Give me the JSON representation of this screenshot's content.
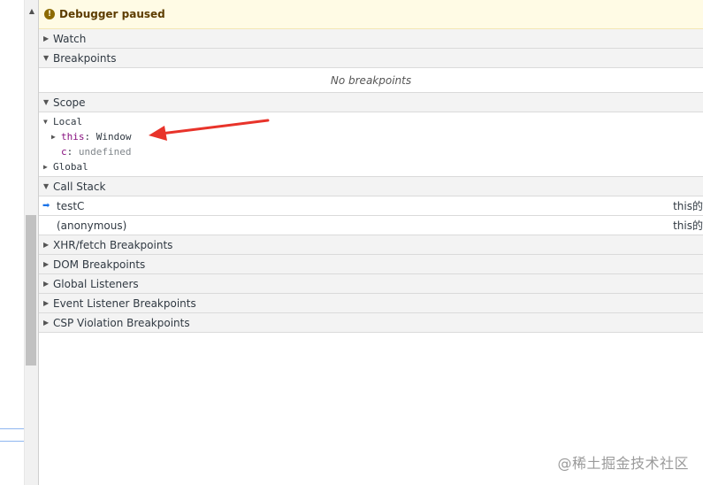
{
  "status": {
    "text": "Debugger paused",
    "icon": "pause-info-icon"
  },
  "sections": {
    "watch": "Watch",
    "breakpoints": "Breakpoints",
    "no_breakpoints": "No breakpoints",
    "scope": "Scope",
    "call_stack": "Call Stack",
    "xhr": "XHR/fetch Breakpoints",
    "dom": "DOM Breakpoints",
    "global_listeners": "Global Listeners",
    "event_listener": "Event Listener Breakpoints",
    "csp": "CSP Violation Breakpoints"
  },
  "scope": {
    "local": "Local",
    "this_name": "this",
    "this_sep": ": ",
    "this_value": "Window",
    "c_name": "c",
    "c_sep": ": ",
    "c_value": "undefined",
    "global": "Global"
  },
  "call_stack": [
    {
      "name": "testC",
      "location": "this的",
      "current": true
    },
    {
      "name": "(anonymous)",
      "location": "this的",
      "current": false
    }
  ],
  "watermark": "@稀土掘金技术社区",
  "colors": {
    "paused_bg": "#fffbe5",
    "annotation_arrow": "#e8332a",
    "current_frame_arrow": "#1a73e8"
  }
}
